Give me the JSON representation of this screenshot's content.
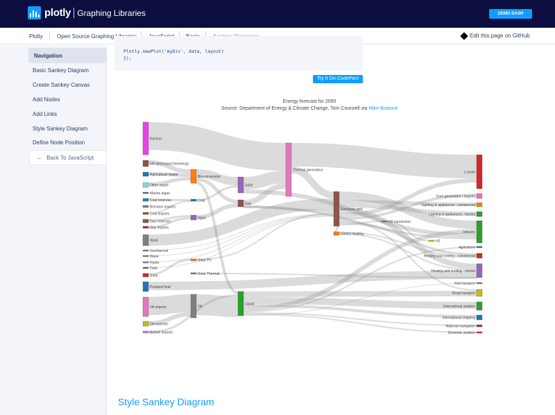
{
  "header": {
    "logo_word": "plotly",
    "logo_sub": "Graphing Libraries",
    "demo_button": "DEMO DASH"
  },
  "breadcrumb": {
    "items": [
      "Plotly",
      "Open Source Graphing Libraries",
      "JavaScript",
      "Basic",
      "Sankey Diagrams"
    ],
    "edit_link": "Edit this page on GitHub"
  },
  "sidebar": {
    "title": "Navigation",
    "items": [
      "Basic Sankey Diagram",
      "Create Sankey Canvas",
      "Add Nodes",
      "Add Links",
      "Style Sankey Diagram",
      "Define Node Position"
    ],
    "back": "Back To JavaScript"
  },
  "code": {
    "line1_prefix": "Plotly.newPlot(",
    "line1_str": "'myDiv'",
    "line1_suffix": ", data, layout)",
    "line2": "});"
  },
  "codepen_button": "Try It On CodePen!",
  "plot": {
    "title_line1": "Energy forecast for 2050",
    "title_line2_prefix": "Source: Department of Energy & Climate Change, Tom Counsell via ",
    "title_line2_link": "Mike Bostock"
  },
  "chart_data": {
    "type": "sankey",
    "title": "Energy forecast for 2050",
    "nodes": [
      {
        "label": "Nuclear",
        "color": "#ec40e6"
      },
      {
        "label": "UK land based bioenergy",
        "color": "#8c564b"
      },
      {
        "label": "Agricultural 'waste'",
        "color": "#1f77b4"
      },
      {
        "label": "Other waste",
        "color": "#7fd6e2"
      },
      {
        "label": "Marine algae",
        "color": "#1f77b4"
      },
      {
        "label": "Coal reserves",
        "color": "#2980b9"
      },
      {
        "label": "Biomass imports",
        "color": "#7f7f7f"
      },
      {
        "label": "Coal imports",
        "color": "#8c564b"
      },
      {
        "label": "Gas reserves",
        "color": "#8c564b"
      },
      {
        "label": "Gas imports",
        "color": "#d62728"
      },
      {
        "label": "Wind",
        "color": "#7f7f7f"
      },
      {
        "label": "Geothermal",
        "color": "#7f7f7f"
      },
      {
        "label": "Wave",
        "color": "#7f7f7f"
      },
      {
        "label": "Hydro",
        "color": "#9467bd"
      },
      {
        "label": "Tidal",
        "color": "#8c564b"
      },
      {
        "label": "Solar",
        "color": "#d62728"
      },
      {
        "label": "Pumped heat",
        "color": "#1f77b4"
      },
      {
        "label": "Oil imports",
        "color": "#e377c2"
      },
      {
        "label": "Oil reserves",
        "color": "#bcbd22"
      },
      {
        "label": "Biofuel imports",
        "color": "#e377c2"
      },
      {
        "label": "Bio-conversion",
        "color": "#ff7f0e"
      },
      {
        "label": "Coal",
        "color": "#1f77b4"
      },
      {
        "label": "Ngas",
        "color": "#9467bd"
      },
      {
        "label": "Solar PV",
        "color": "#ff7f0e"
      },
      {
        "label": "Solar Thermal",
        "color": "#2ca02c"
      },
      {
        "label": "Oil",
        "color": "#7f7f7f"
      },
      {
        "label": "Solid",
        "color": "#9467bd"
      },
      {
        "label": "Gas",
        "color": "#8c564b"
      },
      {
        "label": "Liquid",
        "color": "#2ca02c"
      },
      {
        "label": "Thermal generation",
        "color": "#e377c2"
      },
      {
        "label": "Electricity grid",
        "color": "#8c564b"
      },
      {
        "label": "District heating",
        "color": "#ff7f0e"
      },
      {
        "label": "H2 conversion",
        "color": "#7f7f7f"
      },
      {
        "label": "H2",
        "color": "#bcbd22"
      },
      {
        "label": "Losses",
        "color": "#d62728"
      },
      {
        "label": "Over generation / exports",
        "color": "#e377c2"
      },
      {
        "label": "Lighting & appliances - commercial",
        "color": "#ff7f0e"
      },
      {
        "label": "Lighting & appliances - homes",
        "color": "#2ca02c"
      },
      {
        "label": "Industry",
        "color": "#2ca02c"
      },
      {
        "label": "Agriculture",
        "color": "#1f77b4"
      },
      {
        "label": "Heating and cooling - commercial",
        "color": "#d62728"
      },
      {
        "label": "Heating and cooling - homes",
        "color": "#9467bd"
      },
      {
        "label": "Rail transport",
        "color": "#7f7f7f"
      },
      {
        "label": "Road transport",
        "color": "#bcbd22"
      },
      {
        "label": "International aviation",
        "color": "#2ca02c"
      },
      {
        "label": "International shipping",
        "color": "#1f77b4"
      },
      {
        "label": "National navigation",
        "color": "#d62728"
      },
      {
        "label": "Domestic aviation",
        "color": "#d62728"
      }
    ]
  },
  "section_title": "Style Sankey Diagram"
}
